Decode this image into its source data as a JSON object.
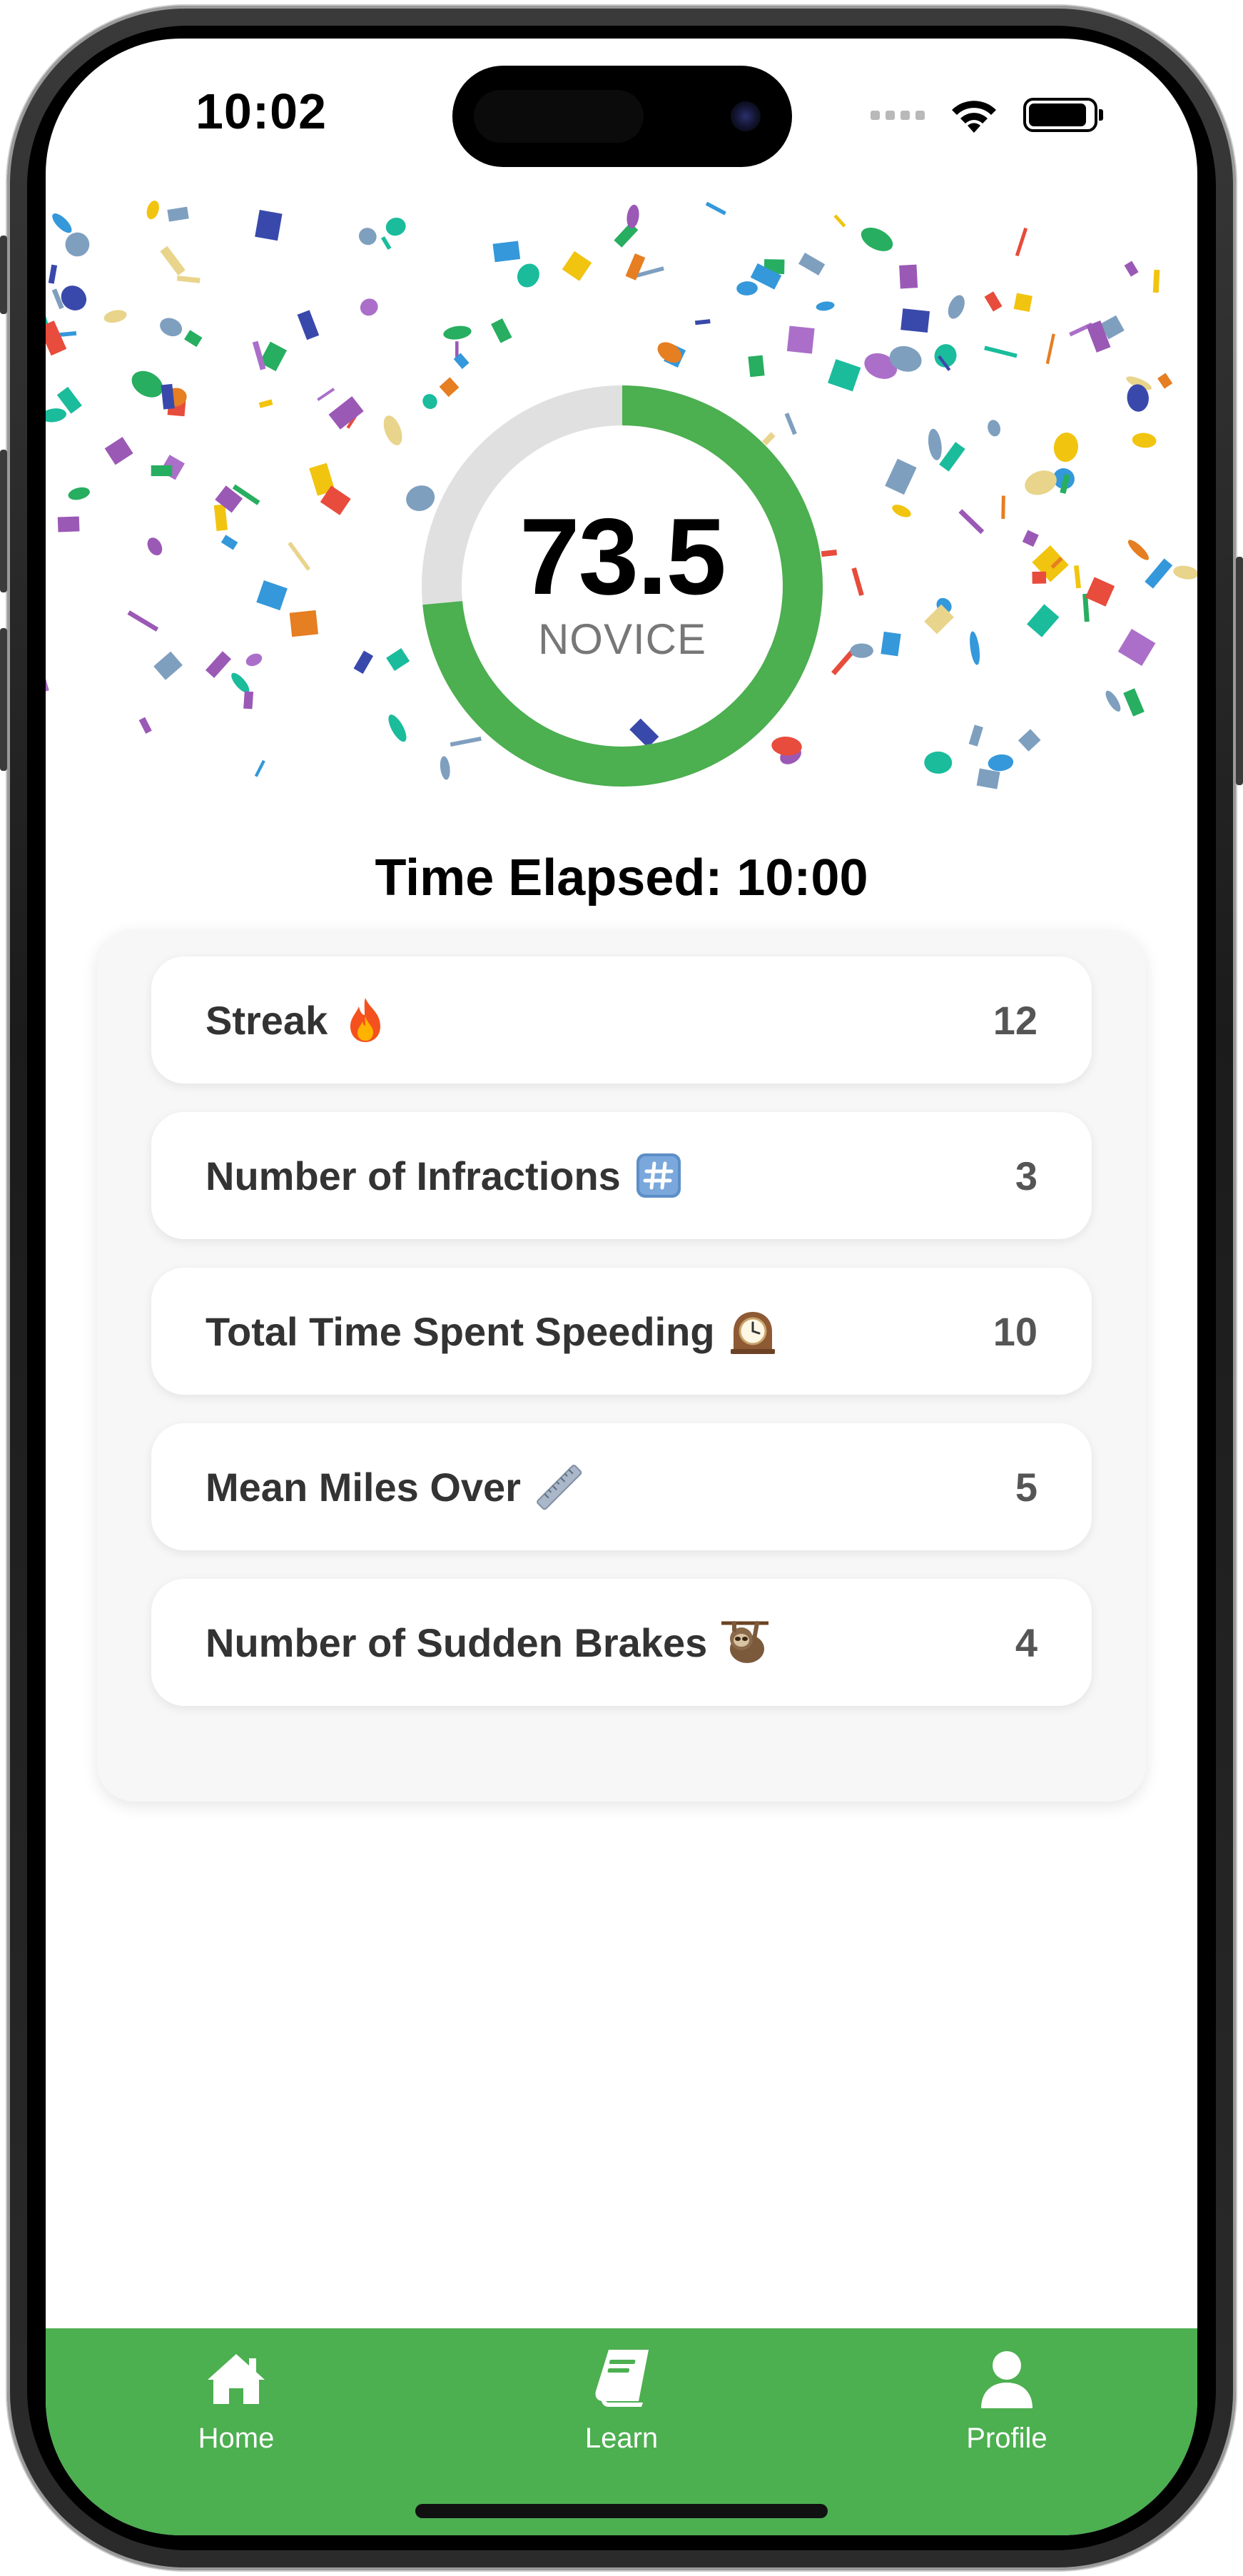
{
  "status_bar": {
    "time": "10:02",
    "icons": [
      "signal-dots-icon",
      "wifi-icon",
      "battery-icon"
    ]
  },
  "score": {
    "value": "73.5",
    "level": "NOVICE",
    "progress_fraction": 0.735,
    "ring_color": "#4caf50",
    "track_color": "#e0e0e0"
  },
  "time_elapsed": "Time Elapsed: 10:00",
  "stats": [
    {
      "label": "Streak",
      "icon": "fire-icon",
      "value": "12"
    },
    {
      "label": "Number of Infractions",
      "icon": "hash-keycap-icon",
      "value": "3"
    },
    {
      "label": "Total Time Spent Speeding",
      "icon": "mantelpiece-clock-icon",
      "value": "10"
    },
    {
      "label": "Mean Miles Over",
      "icon": "ruler-icon",
      "value": "5"
    },
    {
      "label": "Number of Sudden Brakes",
      "icon": "sloth-icon",
      "value": "4"
    }
  ],
  "tabs": [
    {
      "label": "Home",
      "icon": "home-icon"
    },
    {
      "label": "Learn",
      "icon": "book-icon"
    },
    {
      "label": "Profile",
      "icon": "user-icon"
    }
  ],
  "colors": {
    "accent": "#4caf50",
    "panel_bg": "#f7f7f7",
    "label_text": "#333333",
    "value_text": "#555555"
  }
}
